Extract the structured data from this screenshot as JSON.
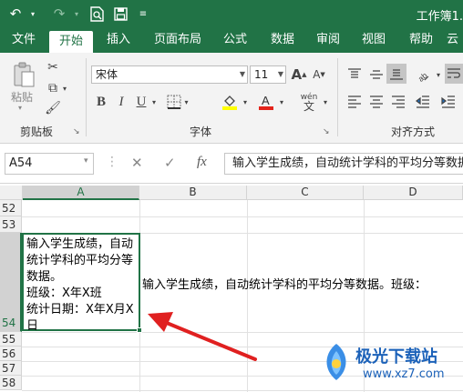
{
  "titlebar": {
    "title": "工作簿1.",
    "undo_icon": "undo-icon",
    "redo_icon": "redo-icon",
    "preview_icon": "print-preview-icon",
    "save_icon": "save-icon",
    "customize_icon": "customize-qat-icon"
  },
  "tabs": [
    {
      "label": "文件"
    },
    {
      "label": "开始"
    },
    {
      "label": "插入"
    },
    {
      "label": "页面布局"
    },
    {
      "label": "公式"
    },
    {
      "label": "数据"
    },
    {
      "label": "审阅"
    },
    {
      "label": "视图"
    },
    {
      "label": "帮助"
    },
    {
      "label": "云"
    }
  ],
  "ribbon": {
    "clipboard": {
      "paste_label": "粘贴",
      "group_label": "剪贴板"
    },
    "font": {
      "font_name": "宋体",
      "font_size": "11",
      "group_label": "字体",
      "phonetic_label": "wén",
      "bold": "B",
      "italic": "I",
      "underline": "U",
      "grow": "A",
      "shrink": "A"
    },
    "alignment": {
      "group_label": "对齐方式"
    },
    "accent_color": "#217346"
  },
  "formula_bar": {
    "name_box": "A54",
    "fx_label": "fx",
    "formula": "输入学生成绩，自动统计学科的平均分等数据。班级：X年X班 统计日期：X年X月X日"
  },
  "sheet": {
    "columns": [
      "A",
      "B",
      "C",
      "D"
    ],
    "rows": [
      "52",
      "53",
      "54",
      "55",
      "56",
      "57",
      "58"
    ],
    "cell_a54": "输入学生成绩，自动统计学科的平均分等数据。\n班级：X年X班\n统计日期：X年X月X日",
    "overflow_text": "输入学生成绩，自动统计学科的平均分等数据。班级："
  },
  "watermark": {
    "name": "极光下载站",
    "url": "www.xz7.com"
  }
}
